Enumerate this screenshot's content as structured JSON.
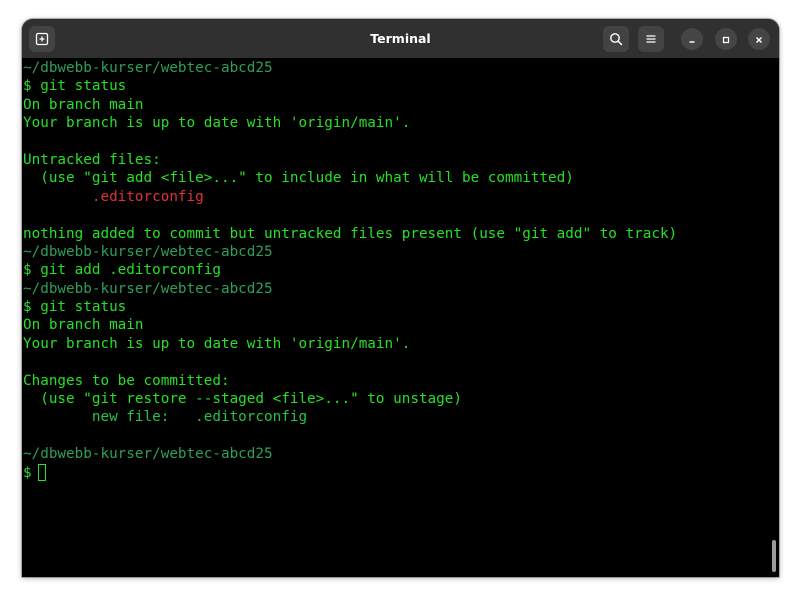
{
  "window": {
    "title": "Terminal"
  },
  "icons": {
    "new_tab": "new-tab-icon",
    "search": "search-icon",
    "menu": "hamburger-menu-icon",
    "minimize": "minimize-icon",
    "maximize": "maximize-icon",
    "close": "close-icon"
  },
  "colors": {
    "prompt_green": "#26e026",
    "path_green": "#2e9f5a",
    "untracked_red": "#e0303a",
    "staged_green": "#26c24a",
    "background": "#000000",
    "headerbar": "#303030"
  },
  "terminal": {
    "lines": [
      {
        "kind": "path",
        "text": "~/dbwebb-kurser/webtec-abcd25"
      },
      {
        "kind": "prompt",
        "text": "$ git status"
      },
      {
        "kind": "out",
        "text": "On branch main"
      },
      {
        "kind": "out",
        "text": "Your branch is up to date with 'origin/main'."
      },
      {
        "kind": "out",
        "text": ""
      },
      {
        "kind": "out",
        "text": "Untracked files:"
      },
      {
        "kind": "out",
        "text": "  (use \"git add <file>...\" to include in what will be committed)"
      },
      {
        "kind": "red",
        "text": "        .editorconfig"
      },
      {
        "kind": "out",
        "text": ""
      },
      {
        "kind": "out",
        "text": "nothing added to commit but untracked files present (use \"git add\" to track)"
      },
      {
        "kind": "path",
        "text": "~/dbwebb-kurser/webtec-abcd25"
      },
      {
        "kind": "prompt",
        "text": "$ git add .editorconfig"
      },
      {
        "kind": "path",
        "text": "~/dbwebb-kurser/webtec-abcd25"
      },
      {
        "kind": "prompt",
        "text": "$ git status"
      },
      {
        "kind": "out",
        "text": "On branch main"
      },
      {
        "kind": "out",
        "text": "Your branch is up to date with 'origin/main'."
      },
      {
        "kind": "out",
        "text": ""
      },
      {
        "kind": "out",
        "text": "Changes to be committed:"
      },
      {
        "kind": "out",
        "text": "  (use \"git restore --staged <file>...\" to unstage)"
      },
      {
        "kind": "green2",
        "text": "        new file:   .editorconfig"
      },
      {
        "kind": "out",
        "text": ""
      },
      {
        "kind": "path",
        "text": "~/dbwebb-kurser/webtec-abcd25"
      }
    ],
    "current_prompt": "$"
  }
}
